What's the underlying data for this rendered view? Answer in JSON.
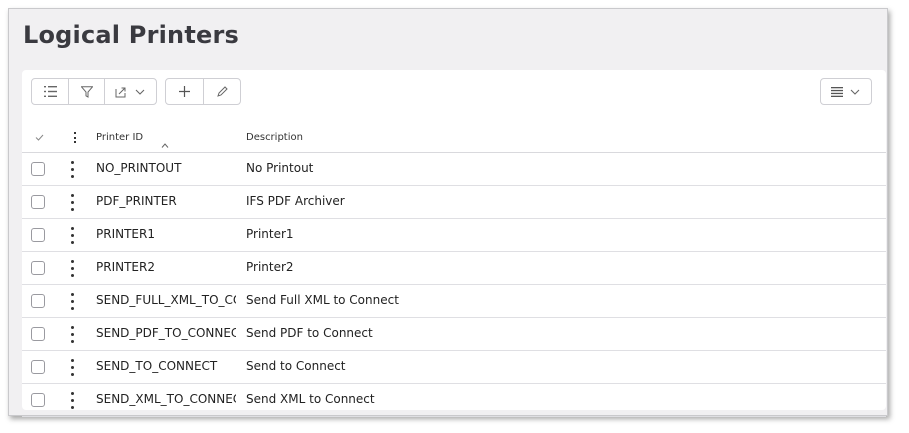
{
  "page": {
    "title": "Logical Printers"
  },
  "toolbar": {
    "icons": [
      "list-icon",
      "filter-icon",
      "export-icon",
      "add-icon",
      "edit-icon",
      "table-settings-icon"
    ]
  },
  "grid": {
    "columns": [
      {
        "key": "printer_id",
        "label": "Printer ID"
      },
      {
        "key": "description",
        "label": "Description"
      }
    ],
    "rows": [
      {
        "printer_id": "NO_PRINTOUT",
        "description": "No Printout"
      },
      {
        "printer_id": "PDF_PRINTER",
        "description": "IFS PDF Archiver"
      },
      {
        "printer_id": "PRINTER1",
        "description": "Printer1"
      },
      {
        "printer_id": "PRINTER2",
        "description": "Printer2"
      },
      {
        "printer_id": "SEND_FULL_XML_TO_CONNECT",
        "description": "Send Full XML to Connect"
      },
      {
        "printer_id": "SEND_PDF_TO_CONNECT",
        "description": "Send PDF to Connect"
      },
      {
        "printer_id": "SEND_TO_CONNECT",
        "description": "Send to Connect"
      },
      {
        "printer_id": "SEND_XML_TO_CONNECT",
        "description": "Send XML to Connect"
      }
    ]
  }
}
